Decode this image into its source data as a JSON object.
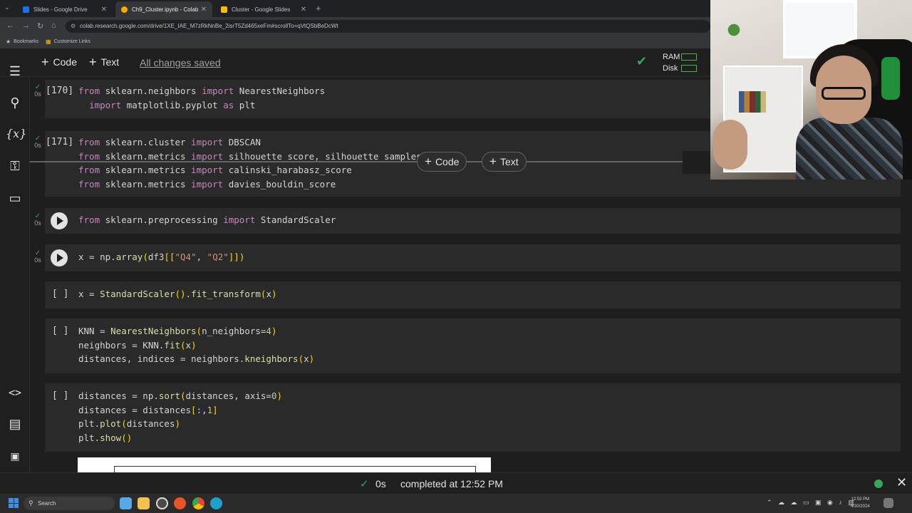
{
  "browser": {
    "tabs": [
      {
        "title": "Slides - Google Drive",
        "favicon_color": "#1a73e8"
      },
      {
        "title": "Ch9_Cluster.ipynb - Colab",
        "favicon_color": "#f9ab00"
      },
      {
        "title": "Cluster - Google Slides",
        "favicon_color": "#fbbc04"
      }
    ],
    "url": "colab.research.google.com/drive/1XE_IAE_M7zRkNnBe_2isrT5Zd465xeFm#scrollTo=qVtQSbBeDcWt",
    "bookmarks": [
      "Bookmarks",
      "Customize Links"
    ]
  },
  "toolbar": {
    "code_label": "Code",
    "text_label": "Text",
    "save_status": "All changes saved",
    "ram_label": "RAM",
    "disk_label": "Disk"
  },
  "cells": [
    {
      "exec": "[170]",
      "time": "0s",
      "lines": [
        [
          [
            "kw",
            "from"
          ],
          [
            "p",
            " sklearn.neighbors "
          ],
          [
            "kw",
            "import"
          ],
          [
            "p",
            " NearestNeighbors"
          ]
        ],
        [
          [
            "p",
            "  "
          ],
          [
            "kw",
            "import"
          ],
          [
            "p",
            " matplotlib.pyplot "
          ],
          [
            "kw",
            "as"
          ],
          [
            "p",
            " plt"
          ]
        ]
      ]
    },
    {
      "exec": "[171]",
      "time": "0s",
      "lines": [
        [
          [
            "kw",
            "from"
          ],
          [
            "p",
            " sklearn.cluster "
          ],
          [
            "kw",
            "import"
          ],
          [
            "p",
            " DBSCAN"
          ]
        ],
        [
          [
            "kw",
            "from"
          ],
          [
            "p",
            " sklearn.metrics "
          ],
          [
            "kw",
            "import"
          ],
          [
            "p",
            " silhouette_score, silhouette_samples"
          ]
        ],
        [
          [
            "kw",
            "from"
          ],
          [
            "p",
            " sklearn.metrics "
          ],
          [
            "kw",
            "import"
          ],
          [
            "p",
            " calinski_harabasz_score"
          ]
        ],
        [
          [
            "kw",
            "from"
          ],
          [
            "p",
            " sklearn.metrics "
          ],
          [
            "kw",
            "import"
          ],
          [
            "p",
            " davies_bouldin_score"
          ]
        ]
      ]
    },
    {
      "exec": "",
      "time": "0s",
      "lines": [
        [
          [
            "kw",
            "from"
          ],
          [
            "p",
            " sklearn.preprocessing "
          ],
          [
            "kw",
            "import"
          ],
          [
            "p",
            " StandardScaler"
          ]
        ]
      ]
    },
    {
      "exec": "",
      "time": "0s",
      "lines": [
        [
          [
            "p",
            "x = np."
          ],
          [
            "fn",
            "array"
          ],
          [
            "pa",
            "("
          ],
          [
            "p",
            "df3"
          ],
          [
            "pa",
            "[["
          ],
          [
            "st",
            "\"Q4\""
          ],
          [
            "p",
            ", "
          ],
          [
            "st",
            "\"Q2\""
          ],
          [
            "pa",
            "]])"
          ]
        ]
      ]
    },
    {
      "exec": "[ ]",
      "time": "",
      "lines": [
        [
          [
            "p",
            "x = "
          ],
          [
            "fn",
            "StandardScaler"
          ],
          [
            "pa",
            "()"
          ],
          [
            "p",
            "."
          ],
          [
            "fn",
            "fit_transform"
          ],
          [
            "pa",
            "("
          ],
          [
            "p",
            "x"
          ],
          [
            "pa",
            ")"
          ]
        ]
      ]
    },
    {
      "exec": "[ ]",
      "time": "",
      "lines": [
        [
          [
            "p",
            "KNN = "
          ],
          [
            "fn",
            "NearestNeighbors"
          ],
          [
            "pa",
            "("
          ],
          [
            "p",
            "n_neighbors="
          ],
          [
            "nm",
            "4"
          ],
          [
            "pa",
            ")"
          ]
        ],
        [
          [
            "p",
            "neighbors = KNN."
          ],
          [
            "fn",
            "fit"
          ],
          [
            "pa",
            "("
          ],
          [
            "p",
            "x"
          ],
          [
            "pa",
            ")"
          ]
        ],
        [
          [
            "p",
            "distances, indices = neighbors."
          ],
          [
            "fn",
            "kneighbors"
          ],
          [
            "pa",
            "("
          ],
          [
            "p",
            "x"
          ],
          [
            "pa",
            ")"
          ]
        ]
      ]
    },
    {
      "exec": "[ ]",
      "time": "",
      "lines": [
        [
          [
            "p",
            "distances = np."
          ],
          [
            "fn",
            "sort"
          ],
          [
            "pa",
            "("
          ],
          [
            "p",
            "distances, axis="
          ],
          [
            "nm",
            "0"
          ],
          [
            "pa",
            ")"
          ]
        ],
        [
          [
            "p",
            "distances = distances"
          ],
          [
            "pa",
            "["
          ],
          [
            "p",
            ":,"
          ],
          [
            "nm",
            "1"
          ],
          [
            "pa",
            "]"
          ]
        ],
        [
          [
            "p",
            "plt."
          ],
          [
            "fn",
            "plot"
          ],
          [
            "pa",
            "("
          ],
          [
            "p",
            "distances"
          ],
          [
            "pa",
            ")"
          ]
        ],
        [
          [
            "p",
            "plt."
          ],
          [
            "fn",
            "show"
          ],
          [
            "pa",
            "()"
          ]
        ]
      ]
    }
  ],
  "insert_bar": {
    "code_label": "Code",
    "text_label": "Text"
  },
  "status": {
    "elapsed": "0s",
    "completed": "completed at 12:52 PM"
  },
  "taskbar": {
    "search_placeholder": "Search",
    "time": "12:53 PM",
    "date": "4/30/2024"
  }
}
